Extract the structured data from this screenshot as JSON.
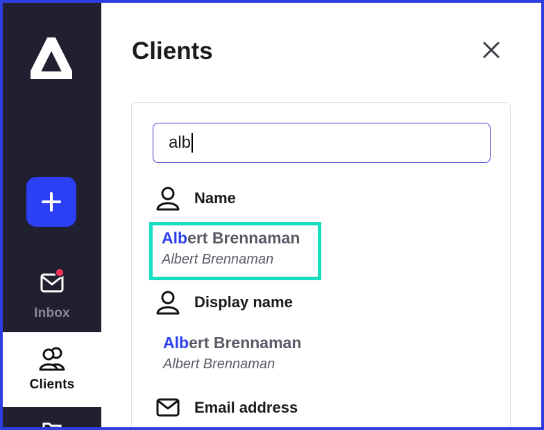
{
  "colors": {
    "frame": "#2b3fe0",
    "sidebar": "#202030",
    "accent": "#2b3ff5",
    "notification": "#ff3355",
    "highlight_outline": "#17ddc2",
    "match_text": "#2b3ff0"
  },
  "sidebar": {
    "logo_icon": "triangle-logo-icon",
    "add_button_icon": "plus-icon",
    "items": [
      {
        "label": "Inbox",
        "icon": "mail-icon",
        "has_notification": true,
        "active": false
      },
      {
        "label": "Clients",
        "icon": "users-icon",
        "active": true
      }
    ]
  },
  "main": {
    "title": "Clients",
    "close_icon": "close-icon",
    "search": {
      "value": "alb"
    },
    "sections": [
      {
        "label": "Name",
        "icon": "user-icon",
        "results": [
          {
            "match": "Alb",
            "rest": "ert Brennaman",
            "secondary": "Albert Brennaman",
            "highlighted": true
          }
        ]
      },
      {
        "label": "Display name",
        "icon": "user-icon",
        "results": [
          {
            "match": "Alb",
            "rest": "ert Brennaman",
            "secondary": "Albert Brennaman",
            "highlighted": false
          }
        ]
      },
      {
        "label": "Email address",
        "icon": "mail-icon",
        "results": []
      }
    ]
  }
}
